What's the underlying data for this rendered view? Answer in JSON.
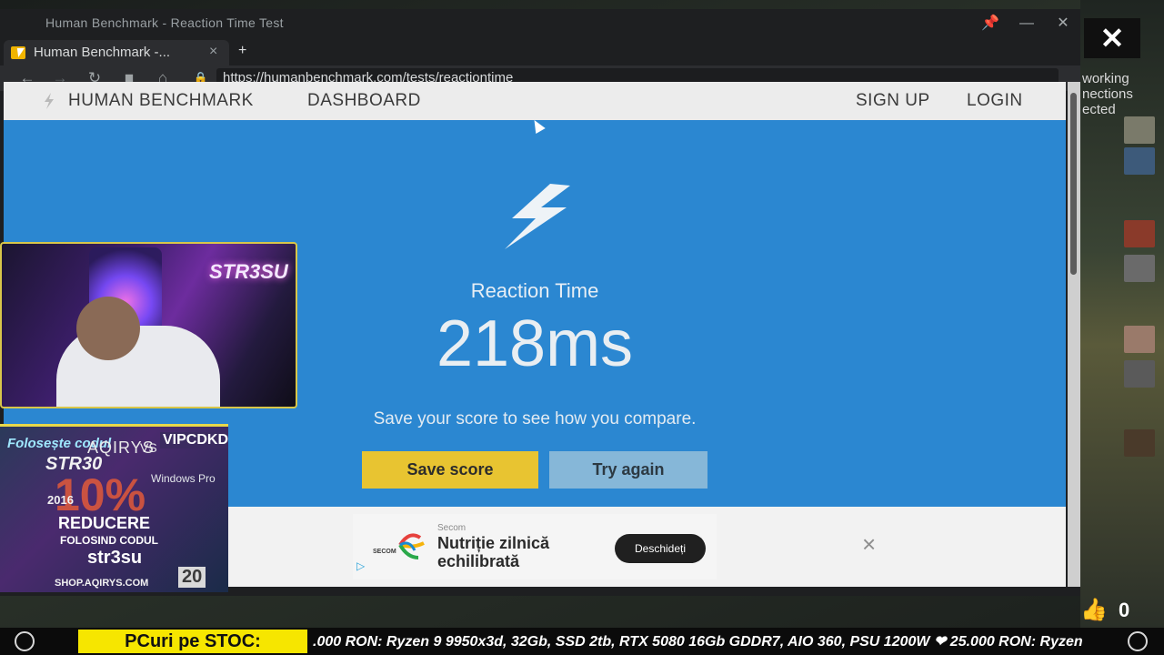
{
  "window": {
    "title": "Human Benchmark - Reaction Time Test"
  },
  "tab": {
    "title": "Human Benchmark -...",
    "close": "×",
    "new_tab": "+"
  },
  "address_bar": {
    "url": "https://humanbenchmark.com/tests/reactiontime"
  },
  "site_header": {
    "brand": "HUMAN BENCHMARK",
    "nav": [
      "DASHBOARD"
    ],
    "auth": [
      "SIGN UP",
      "LOGIN"
    ]
  },
  "result": {
    "label": "Reaction Time",
    "value": "218ms",
    "hint": "Save your score to see how you compare.",
    "save_label": "Save score",
    "retry_label": "Try again"
  },
  "ad": {
    "logo_text": "SECOM",
    "sponsor": "Secom",
    "headline": "Nutriție zilnică echilibrată",
    "cta": "Deschideți",
    "close": "×"
  },
  "side_panel": {
    "lines": [
      "working",
      "nections",
      "ected"
    ]
  },
  "overlay": {
    "close": "✕"
  },
  "webcam": {
    "sign": "STR3SU"
  },
  "promo": {
    "code_hint": "Folosește codul",
    "code": "STR30",
    "brand": "AQIRYS",
    "vs": "VS",
    "partner": "VIPCDKDEALS",
    "percent": "10%",
    "year": "2016",
    "os": "Windows Pro",
    "reducere": "REDUCERE",
    "folosind": "FOLOSIND CODUL",
    "user": "str3su",
    "shop": "SHOP.AQIRYS.COM",
    "badge": "20"
  },
  "ticker": {
    "label": "PCuri pe STOC:",
    "text": ".000 RON: Ryzen 9 9950x3d, 32Gb, SSD 2tb, RTX 5080 16Gb GDDR7, AIO 360, PSU 1200W ❤ 25.000 RON: Ryzen"
  },
  "likes": {
    "count": "0"
  },
  "colors": {
    "page_blue": "#2b87d1",
    "save_yellow": "#e8c431",
    "retry_blue": "#86b7d8",
    "ticker_yellow": "#f6e600"
  }
}
